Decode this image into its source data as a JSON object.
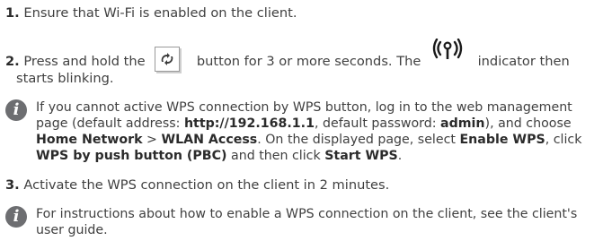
{
  "steps": [
    {
      "number": "1.",
      "text": "Ensure that Wi-Fi is enabled on the client."
    },
    {
      "number": "2.",
      "text_a": "Press and hold the",
      "text_b": "button for 3 or more seconds. The",
      "text_c": "indicator then",
      "text_d": "starts blinking."
    },
    {
      "number": "3.",
      "text": "Activate the WPS connection on the client in 2 minutes."
    }
  ],
  "notes": [
    {
      "icon": "info-icon",
      "glyph": "i",
      "segments": [
        "If you cannot active WPS connection by WPS button, log in to the web management page (default address: ",
        "http://192.168.1.1",
        ", default password: ",
        "admin",
        "), and choose ",
        "Home Network",
        " > ",
        "WLAN Access",
        ". On the displayed page, select ",
        "Enable WPS",
        ", click ",
        "WPS by push button (PBC)",
        " and then click ",
        "Start WPS",
        "."
      ]
    },
    {
      "icon": "info-icon",
      "glyph": "i",
      "text": "For instructions about how to enable a WPS connection on the client, see the client's user guide."
    }
  ],
  "colors": {
    "text": "#404040",
    "icon_bg": "#6d6e71"
  }
}
